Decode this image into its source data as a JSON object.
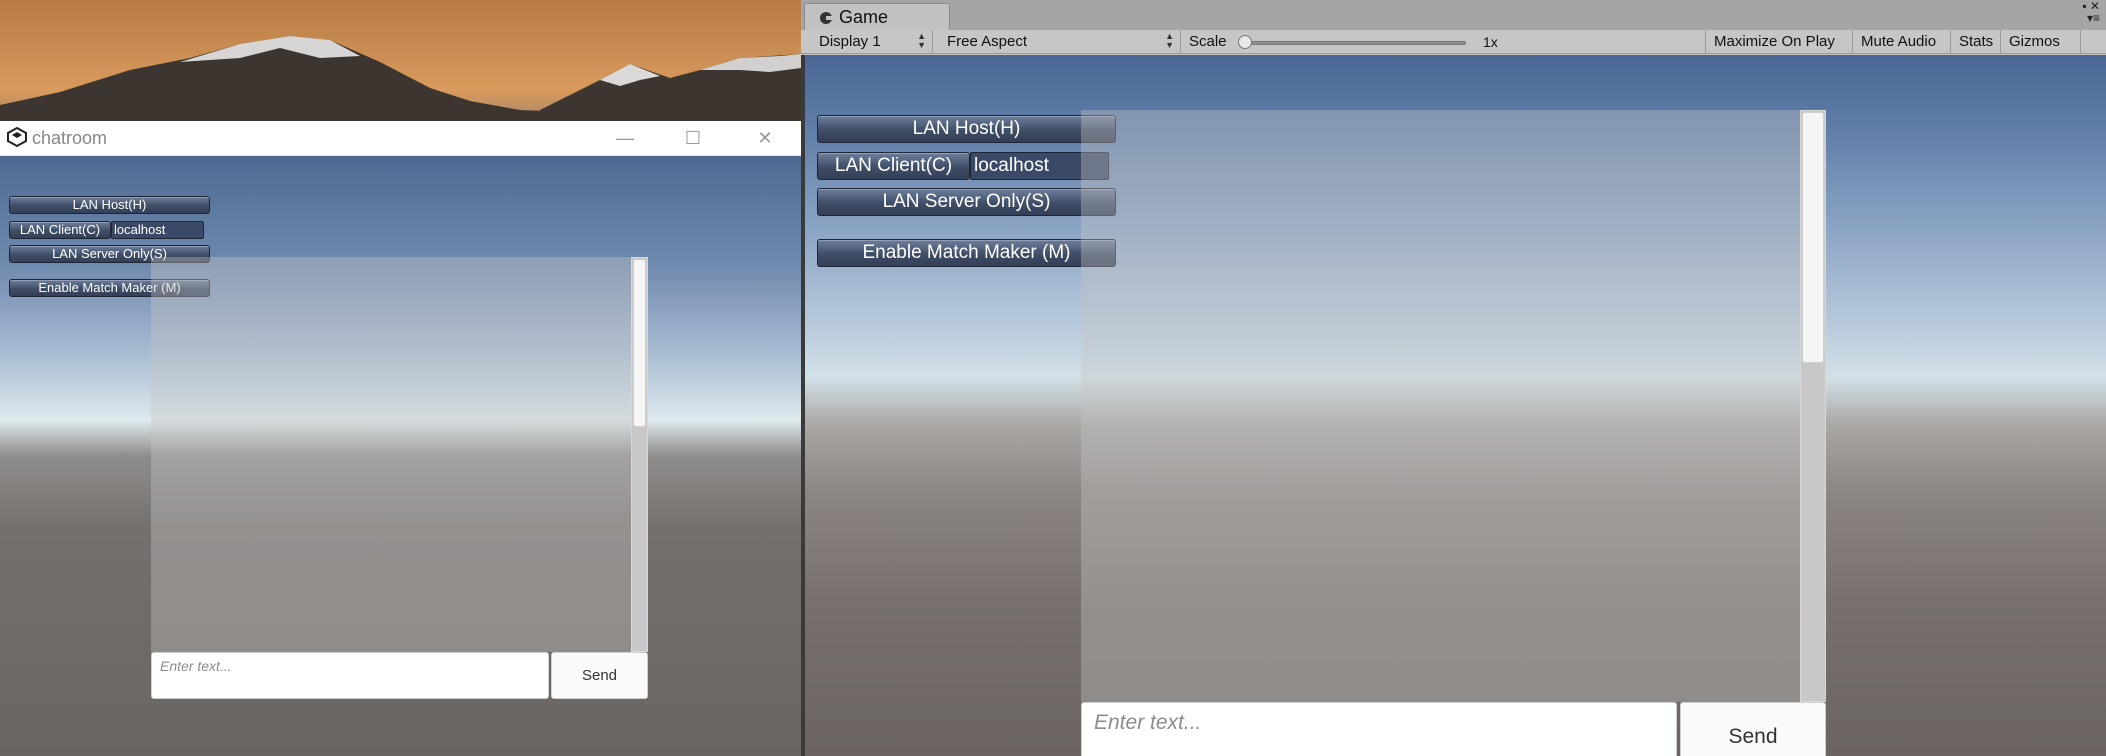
{
  "standalone_window": {
    "title": "chatroom",
    "buttons": {
      "lan_host": "LAN Host(H)",
      "lan_client": "LAN Client(C)",
      "client_address": "localhost",
      "lan_server_only": "LAN Server Only(S)",
      "enable_match_maker": "Enable Match Maker (M)"
    },
    "chat": {
      "input_placeholder": "Enter text...",
      "send_label": "Send"
    }
  },
  "editor_game_view": {
    "tab_title": "Game",
    "toolbar": {
      "display": "Display 1",
      "aspect": "Free Aspect",
      "scale_label": "Scale",
      "scale_value": "1x",
      "maximize_on_play": "Maximize On Play",
      "mute_audio": "Mute Audio",
      "stats": "Stats",
      "gizmos": "Gizmos"
    },
    "buttons": {
      "lan_host": "LAN Host(H)",
      "lan_client": "LAN Client(C)",
      "client_address": "localhost",
      "lan_server_only": "LAN Server Only(S)",
      "enable_match_maker": "Enable Match Maker (M)"
    },
    "chat": {
      "input_placeholder": "Enter text...",
      "send_label": "Send"
    }
  },
  "icons": [
    "unity-logo-icon",
    "minimize-icon",
    "maximize-icon",
    "close-icon",
    "game-tab-icon",
    "dropdown-arrows-icon",
    "panel-menu-icon"
  ]
}
